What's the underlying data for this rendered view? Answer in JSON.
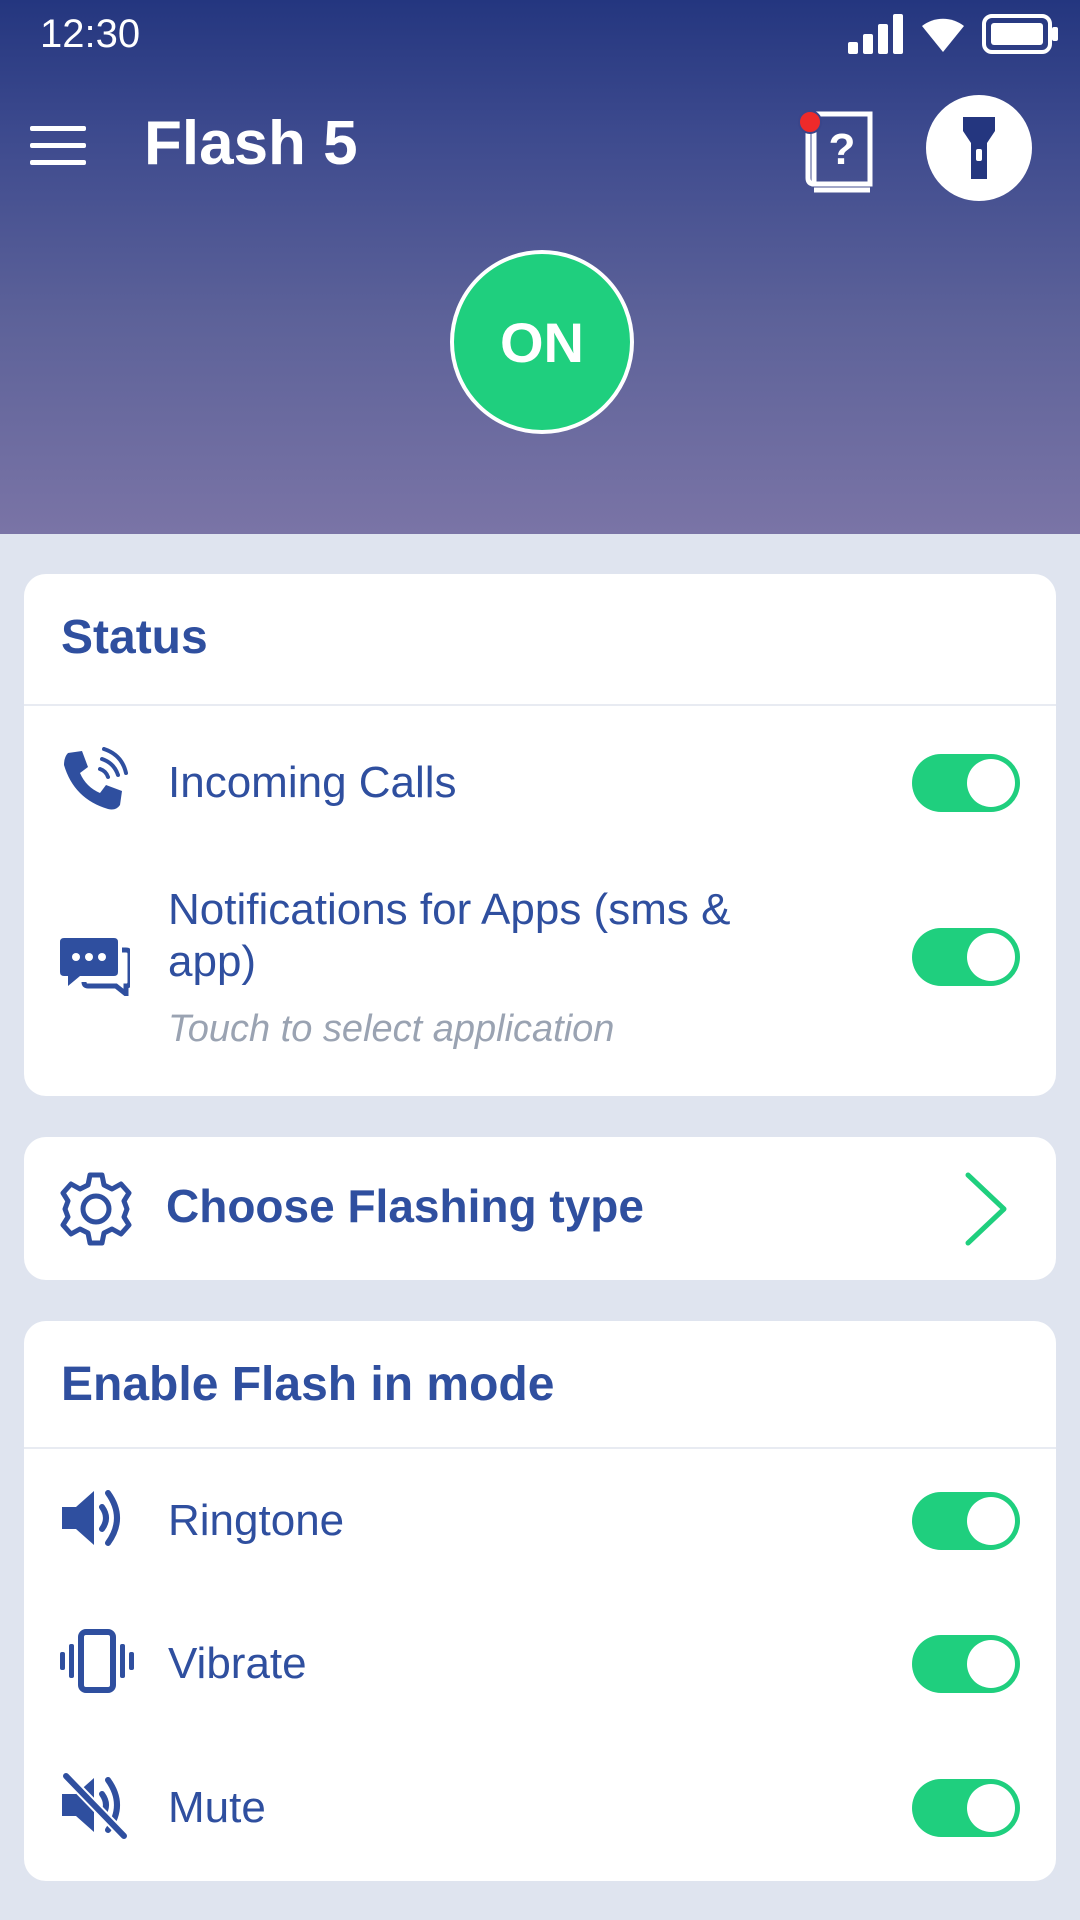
{
  "status_bar": {
    "time": "12:30"
  },
  "app_bar": {
    "title": "Flash 5"
  },
  "power_button": {
    "label": "ON"
  },
  "status_card": {
    "title": "Status",
    "incoming_calls": {
      "label": "Incoming Calls",
      "enabled": true
    },
    "notifications": {
      "label_line1": "Notifications for Apps (sms &",
      "label_line2": "app)",
      "hint": "Touch to select application",
      "enabled": true
    }
  },
  "flashing_type": {
    "label": "Choose Flashing type"
  },
  "mode_card": {
    "title": "Enable Flash in mode",
    "items": [
      {
        "label": "Ringtone",
        "icon": "speaker-icon",
        "enabled": true
      },
      {
        "label": "Vibrate",
        "icon": "vibrate-icon",
        "enabled": true
      },
      {
        "label": "Mute",
        "icon": "mute-icon",
        "enabled": true
      }
    ]
  },
  "colors": {
    "accent": "#1fcf7e",
    "primary_text": "#2f4f9f",
    "header_top": "#24367f",
    "header_bottom": "#7a74a6",
    "background": "#dfe4ef"
  }
}
